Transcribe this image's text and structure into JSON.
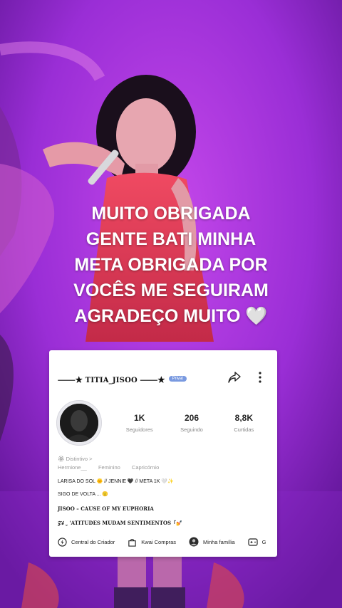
{
  "caption": {
    "lines": [
      "MUITO OBRIGADA",
      "GENTE BATI MINHA",
      "META OBRIGADA POR",
      "VOCÊS ME SEGUIRAM",
      "AGRADEÇO MUITO 🤍"
    ]
  },
  "profile": {
    "username": "⸻★ TITIA_JISOO ⸻★",
    "badge": "Privat",
    "stats": [
      {
        "value": "1K",
        "label": "Seguidores"
      },
      {
        "value": "206",
        "label": "Seguindo"
      },
      {
        "value": "8,8K",
        "label": "Curtidas"
      }
    ],
    "distinction": "🏵 Distintivo >",
    "tags": [
      "Hermione__",
      "Feminino",
      "Capricórnio"
    ],
    "bio_lines": [
      "LARISA DO SOL 🌞 // JENNIE 🖤 // META 1K 🤍✨",
      "SIGO DE VOLTA ... 🙂",
      "JISOO – CAUSE OF MY EUPHORIA",
      "𝒵𝒷 ⌄ 'ATITUDES MUDAM SENTIMENTOS「💅"
    ]
  },
  "bottom_bar": [
    {
      "label": "Central do Criador",
      "icon": "lightning-circle-icon"
    },
    {
      "label": "Kwai Compras",
      "icon": "shopping-bag-icon"
    },
    {
      "label": "Minha família",
      "icon": "family-avatar-icon"
    },
    {
      "label": "G",
      "icon": "gamepad-icon"
    }
  ],
  "colors": {
    "background": "#6a1aa0",
    "stage_glow": "#c43fe8",
    "dress": "#e0405a",
    "caption_text": "#ffffff",
    "badge": "#7a9ae0"
  }
}
